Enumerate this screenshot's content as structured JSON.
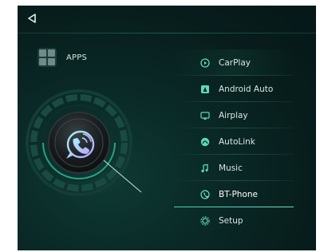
{
  "top_bar": {
    "back_icon": "back-triangle-icon"
  },
  "apps": {
    "label": "APPS",
    "icon": "apps-grid-icon"
  },
  "dial": {
    "icon": "bt-phone-icon",
    "active_app": "BT-Phone"
  },
  "menu": {
    "items": [
      {
        "label": "CarPlay",
        "icon": "carplay-icon"
      },
      {
        "label": "Android Auto",
        "icon": "android-auto-icon"
      },
      {
        "label": "Airplay",
        "icon": "airplay-icon"
      },
      {
        "label": "AutoLink",
        "icon": "autolink-icon"
      },
      {
        "label": "Music",
        "icon": "music-icon"
      },
      {
        "label": "BT-Phone",
        "icon": "bt-phone-icon",
        "selected": true
      },
      {
        "label": "Setup",
        "icon": "setup-gear-icon"
      }
    ]
  },
  "colors": {
    "accent": "#5fd8bb",
    "background": "#0a2a27",
    "text": "#d9e6e3"
  }
}
